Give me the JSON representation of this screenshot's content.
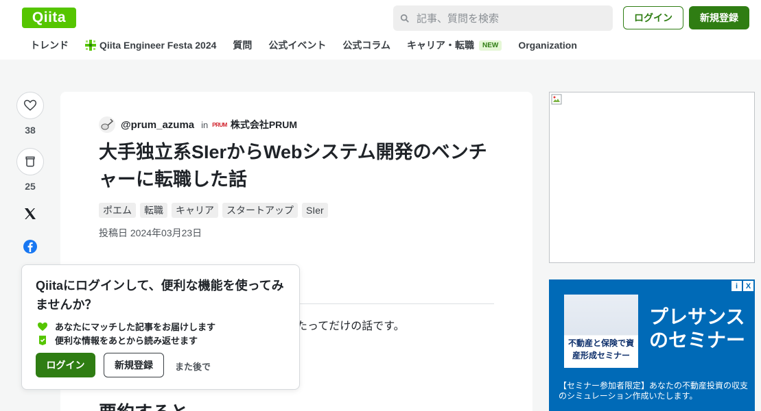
{
  "header": {
    "logo_text": "Qiita",
    "search_placeholder": "記事、質問を検索",
    "login_label": "ログイン",
    "signup_label": "新規登録",
    "accent_color": "#55c500",
    "button_color": "#2f7d13"
  },
  "nav": {
    "items": [
      {
        "label": "トレンド"
      },
      {
        "label": "Qiita Engineer Festa 2024",
        "icon": "festa-icon"
      },
      {
        "label": "質問"
      },
      {
        "label": "公式イベント"
      },
      {
        "label": "公式コラム"
      },
      {
        "label": "キャリア・転職",
        "badge": "NEW"
      },
      {
        "label": "Organization"
      }
    ]
  },
  "actions": {
    "like_count": "38",
    "stock_count": "25"
  },
  "article": {
    "author": "@prum_azuma",
    "in_text": "in",
    "org_logo_text": "PRUM",
    "org_name": "株式会社PRUM",
    "title": "大手独立系SIerからWebシステム開発のベンチャーに転職した話",
    "tags": [
      "ポエム",
      "転職",
      "キャリア",
      "スタートアップ",
      "SIer"
    ],
    "posted": "投稿日 2024年03月23日",
    "body_fragment": "たってだけの話です。",
    "heading_fragment": "要約すると"
  },
  "popup": {
    "title": "Qiitaにログインして、便利な機能を使ってみませんか？",
    "perk1": "あなたにマッチした記事をお届けします",
    "perk2": "便利な情報をあとから読み返せます",
    "login_label": "ログイン",
    "signup_label": "新規登録",
    "later_label": "また後で"
  },
  "ad": {
    "photo_text": "不動産と保険で資産形成セミナー",
    "headline": "プレサンスのセミナー",
    "copy": "【セミナー参加者限定】あなたの不動産投資の収支のシミュレーション作成いたします。",
    "choice_i": "i",
    "choice_x": "X"
  }
}
